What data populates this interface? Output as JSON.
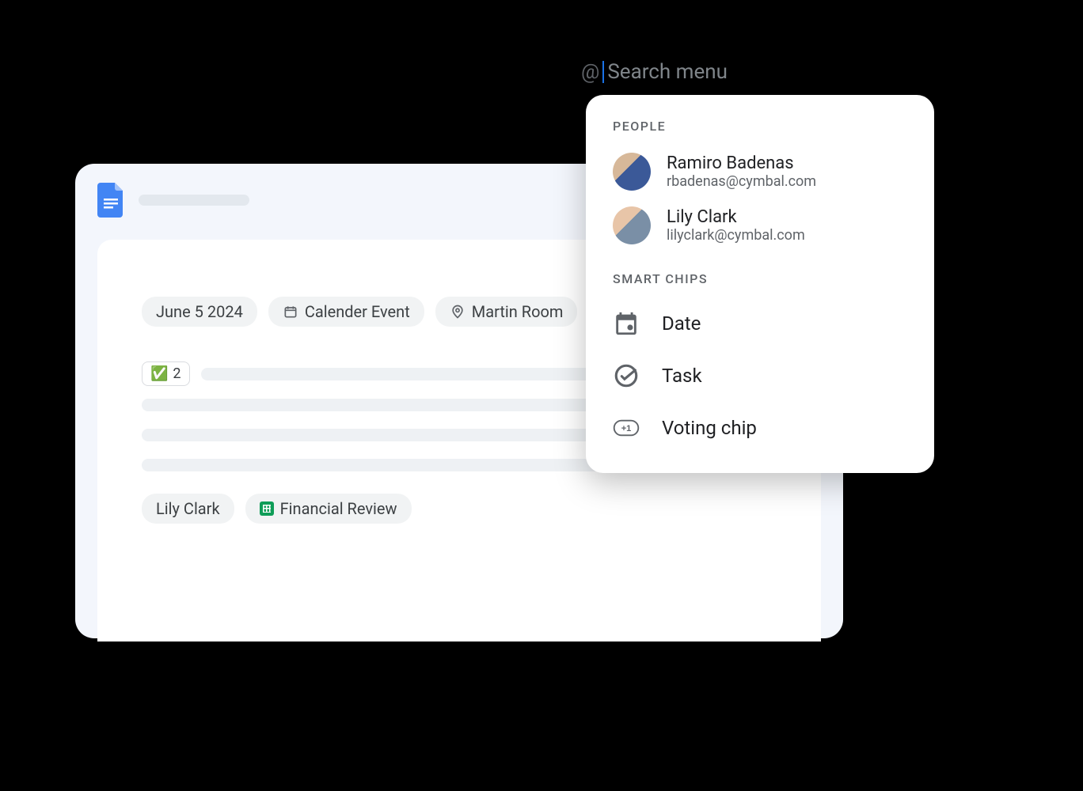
{
  "mention": {
    "at": "@",
    "placeholder": "Search menu"
  },
  "doc": {
    "chips_top": {
      "date": "June 5 2024",
      "event": "Calender Event",
      "place": "Martin Room"
    },
    "vote_count": "2",
    "chips_bottom": {
      "person": "Lily Clark",
      "file": "Financial Review"
    }
  },
  "dropdown": {
    "people_header": "PEOPLE",
    "chips_header": "SMART CHIPS",
    "people": [
      {
        "name": "Ramiro Badenas",
        "email": "rbadenas@cymbal.com"
      },
      {
        "name": "Lily Clark",
        "email": "lilyclark@cymbal.com"
      }
    ],
    "chip_options": {
      "date": "Date",
      "task": "Task",
      "voting": "Voting chip"
    }
  }
}
